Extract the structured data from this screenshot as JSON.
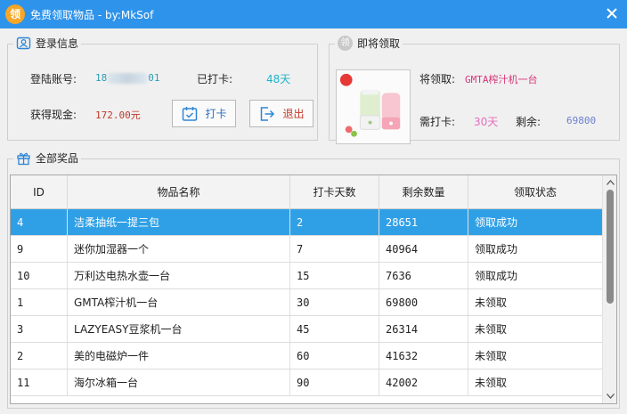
{
  "window": {
    "app_icon_text": "领",
    "title": "免费领取物品 - by:MkSof"
  },
  "login_panel": {
    "title": "登录信息",
    "account_label": "登陆账号:",
    "account_prefix": "18",
    "account_suffix": "01",
    "checked_label": "已打卡:",
    "checked_value": "48天",
    "cash_label": "获得现金:",
    "cash_value": "172.00元",
    "checkin_button": "打卡",
    "logout_button": "退出"
  },
  "claim_panel": {
    "title": "即将领取",
    "title_icon_text": "领",
    "claim_label": "将领取:",
    "claim_value": "GMTA榨汁机一台",
    "need_label": "需打卡:",
    "need_value": "30天",
    "remain_label": "剩余:",
    "remain_value": "69800"
  },
  "prizes_panel": {
    "title": "全部奖品",
    "columns": [
      "ID",
      "物品名称",
      "打卡天数",
      "剩余数量",
      "领取状态"
    ],
    "rows": [
      {
        "id": "4",
        "name": "洁柔抽纸一提三包",
        "days": "2",
        "remain": "28651",
        "status": "领取成功"
      },
      {
        "id": "9",
        "name": "迷你加湿器一个",
        "days": "7",
        "remain": "40964",
        "status": "领取成功"
      },
      {
        "id": "10",
        "name": "万利达电热水壶一台",
        "days": "15",
        "remain": "7636",
        "status": "领取成功"
      },
      {
        "id": "1",
        "name": "GMTA榨汁机一台",
        "days": "30",
        "remain": "69800",
        "status": "未领取"
      },
      {
        "id": "3",
        "name": "LAZYEASY豆浆机一台",
        "days": "45",
        "remain": "26314",
        "status": "未领取"
      },
      {
        "id": "2",
        "name": "美的电磁炉一件",
        "days": "60",
        "remain": "41632",
        "status": "未领取"
      },
      {
        "id": "11",
        "name": "海尔冰箱一台",
        "days": "90",
        "remain": "42002",
        "status": "未领取"
      }
    ],
    "selected_row": 0
  },
  "colors": {
    "titlebar": "#2e93ea",
    "selected_row": "#30a0e6",
    "checked_value": "#1fb3c9",
    "cash_value": "#c0392b",
    "claim_value": "#d6357a",
    "need_value": "#e26fbd",
    "remain_value": "#6c7fd0",
    "account_value": "#2a9db0"
  },
  "icons": {
    "close": "close-icon",
    "login": "user-card-icon",
    "claim": "claim-badge-icon",
    "prizes": "gift-icon",
    "checkin": "calendar-check-icon",
    "logout": "exit-icon"
  }
}
